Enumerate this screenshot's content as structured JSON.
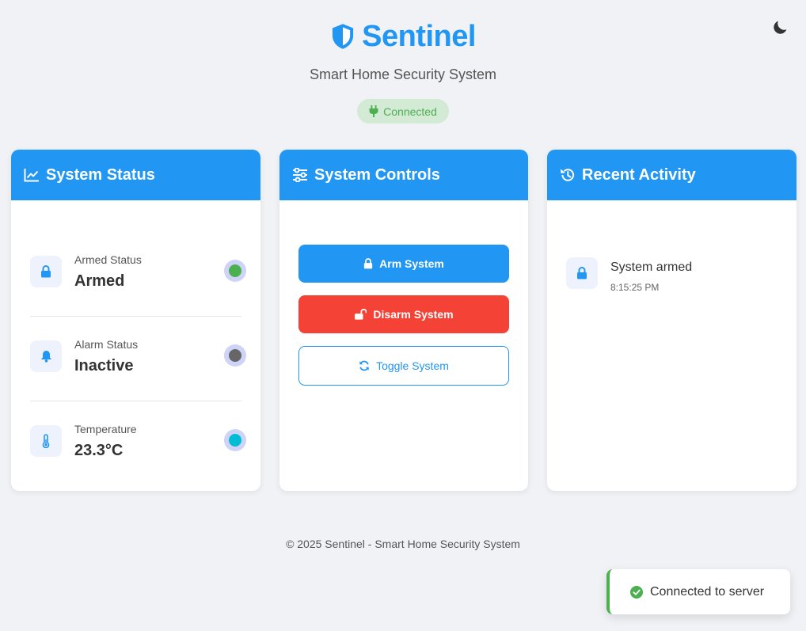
{
  "app": {
    "title": "Sentinel",
    "subtitle": "Smart Home Security System",
    "connection_badge": "Connected"
  },
  "status_card": {
    "title": "System Status",
    "items": [
      {
        "label": "Armed Status",
        "value": "Armed",
        "icon": "lock-icon",
        "indicator_color": "#4caf50"
      },
      {
        "label": "Alarm Status",
        "value": "Inactive",
        "icon": "bell-icon",
        "indicator_color": "#666666"
      },
      {
        "label": "Temperature",
        "value": "23.3°C",
        "icon": "thermometer-icon",
        "indicator_color": "#00bcd4"
      }
    ]
  },
  "controls_card": {
    "title": "System Controls",
    "arm_label": "Arm System",
    "disarm_label": "Disarm System",
    "toggle_label": "Toggle System"
  },
  "activity_card": {
    "title": "Recent Activity",
    "items": [
      {
        "text": "System armed",
        "time": "8:15:25 PM",
        "icon": "lock-icon"
      }
    ]
  },
  "footer": {
    "text": "© 2025 Sentinel - Smart Home Security System"
  },
  "toast": {
    "message": "Connected to server"
  },
  "colors": {
    "primary": "#2196f3",
    "danger": "#f44336",
    "success": "#4caf50",
    "background": "#f0f2f5"
  }
}
